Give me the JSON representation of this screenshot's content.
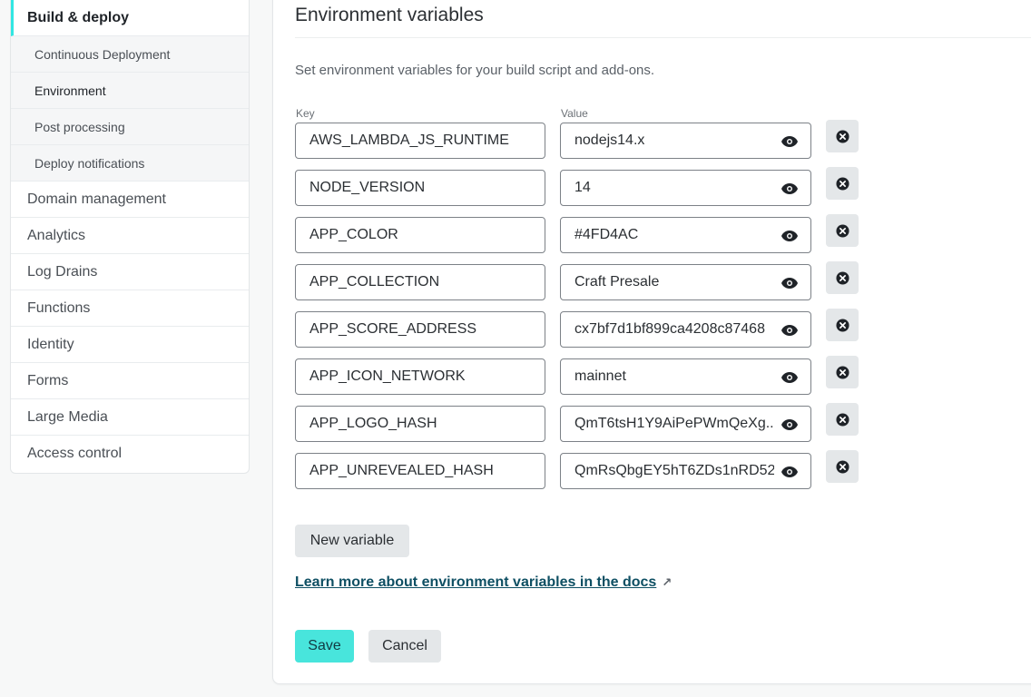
{
  "sidebar": {
    "items": [
      {
        "label": "Build & deploy",
        "active": true
      },
      {
        "label": "Domain management"
      },
      {
        "label": "Analytics"
      },
      {
        "label": "Log Drains"
      },
      {
        "label": "Functions"
      },
      {
        "label": "Identity"
      },
      {
        "label": "Forms"
      },
      {
        "label": "Large Media"
      },
      {
        "label": "Access control"
      }
    ],
    "sub_items": [
      {
        "label": "Continuous Deployment"
      },
      {
        "label": "Environment"
      },
      {
        "label": "Post processing"
      },
      {
        "label": "Deploy notifications"
      }
    ]
  },
  "main": {
    "title": "Environment variables",
    "description": "Set environment variables for your build script and add-ons.",
    "key_label": "Key",
    "value_label": "Value",
    "variables": [
      {
        "key": "AWS_LAMBDA_JS_RUNTIME",
        "value": "nodejs14.x"
      },
      {
        "key": "NODE_VERSION",
        "value": "14"
      },
      {
        "key": "APP_COLOR",
        "value": "#4FD4AC"
      },
      {
        "key": "APP_COLLECTION",
        "value": "Craft Presale"
      },
      {
        "key": "APP_SCORE_ADDRESS",
        "value": "cx7bf7d1bf899ca4208c87468"
      },
      {
        "key": "APP_ICON_NETWORK",
        "value": "mainnet"
      },
      {
        "key": "APP_LOGO_HASH",
        "value": "QmT6tsH1Y9AiPePWmQeXg..."
      },
      {
        "key": "APP_UNREVEALED_HASH",
        "value": "QmRsQbgEY5hT6ZDs1nRD52"
      }
    ],
    "new_variable_label": "New variable",
    "docs_link_label": "Learn more about environment variables in the docs",
    "docs_link_arrow": "↗",
    "save_label": "Save",
    "cancel_label": "Cancel"
  },
  "icons": {
    "eye": "eye-icon",
    "remove": "close-circle-icon",
    "external": "external-link-icon"
  },
  "colors": {
    "accent": "#32E6E2",
    "save_button": "#48E5DC",
    "link": "#0E4F63"
  }
}
